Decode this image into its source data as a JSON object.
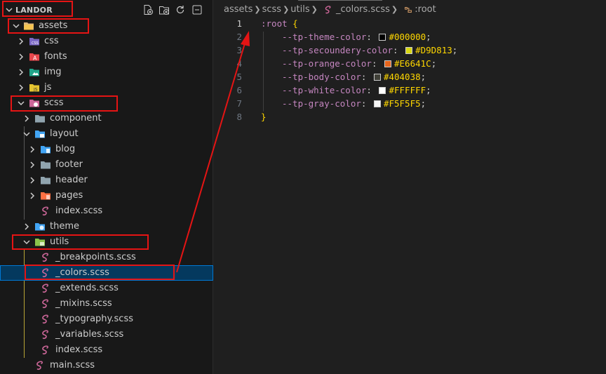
{
  "explorer": {
    "root_title": "LANDOR",
    "tree": [
      {
        "label": "assets",
        "icon": "folder-open-icon"
      },
      {
        "label": "css",
        "icon": "css-folder-icon"
      },
      {
        "label": "fonts",
        "icon": "fonts-folder-icon"
      },
      {
        "label": "img",
        "icon": "images-folder-icon"
      },
      {
        "label": "js",
        "icon": "js-folder-icon"
      },
      {
        "label": "scss",
        "icon": "scss-folder-icon"
      },
      {
        "label": "component",
        "icon": "folder-icon"
      },
      {
        "label": "layout",
        "icon": "layout-folder-icon"
      },
      {
        "label": "blog",
        "icon": "blog-folder-icon"
      },
      {
        "label": "footer",
        "icon": "folder-icon"
      },
      {
        "label": "header",
        "icon": "folder-icon"
      },
      {
        "label": "pages",
        "icon": "pages-folder-icon"
      },
      {
        "label": "index.scss",
        "icon": "sass-file-icon"
      },
      {
        "label": "theme",
        "icon": "theme-folder-icon"
      },
      {
        "label": "utils",
        "icon": "utils-folder-icon"
      },
      {
        "label": "_breakpoints.scss",
        "icon": "sass-file-icon"
      },
      {
        "label": "_colors.scss",
        "icon": "sass-file-icon"
      },
      {
        "label": "_extends.scss",
        "icon": "sass-file-icon"
      },
      {
        "label": "_mixins.scss",
        "icon": "sass-file-icon"
      },
      {
        "label": "_typography.scss",
        "icon": "sass-file-icon"
      },
      {
        "label": "_variables.scss",
        "icon": "sass-file-icon"
      },
      {
        "label": "index.scss",
        "icon": "sass-file-icon"
      },
      {
        "label": "main.scss",
        "icon": "sass-file-icon"
      }
    ]
  },
  "breadcrumb": {
    "items": [
      "assets",
      "scss",
      "utils",
      "_colors.scss",
      ":root"
    ]
  },
  "editor": {
    "line_numbers": [
      "1",
      "2",
      "3",
      "4",
      "5",
      "6",
      "7",
      "8"
    ],
    "selector": ":root",
    "open_brace": "{",
    "close_brace": "}",
    "declarations": [
      {
        "property": "--tp-theme-color",
        "value": "#000000",
        "swatch": "#000000"
      },
      {
        "property": "--tp-secoundery-color",
        "value": "#D9D813",
        "swatch": "#D9D813"
      },
      {
        "property": "--tp-orange-color",
        "value": "#E6641C",
        "swatch": "#E6641C"
      },
      {
        "property": "--tp-body-color",
        "value": "#404038",
        "swatch": "#404038"
      },
      {
        "property": "--tp-white-color",
        "value": "#FFFFFF",
        "swatch": "#FFFFFF"
      },
      {
        "property": "--tp-gray-color",
        "value": "#F5F5F5",
        "swatch": "#F5F5F5"
      }
    ]
  },
  "colors": {
    "annotation_red": "#e51414",
    "selection_border": "#0078d4",
    "sass_pink": "#cd6799"
  }
}
